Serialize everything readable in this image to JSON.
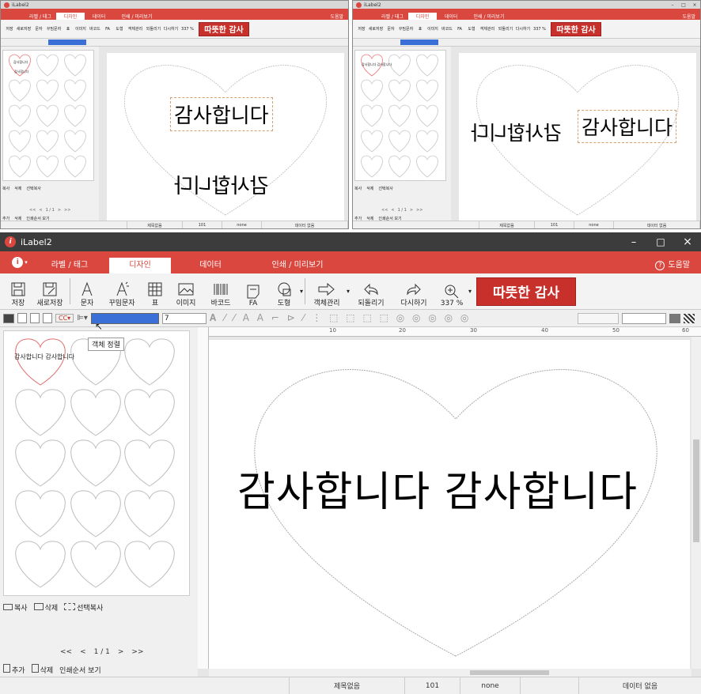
{
  "app": {
    "title": "iLabel2"
  },
  "tabs": [
    {
      "label": "라벨 / 태그"
    },
    {
      "label": "디자인"
    },
    {
      "label": "데이터"
    },
    {
      "label": "인쇄 / 미리보기"
    }
  ],
  "help_label": "도움말",
  "ribbon": [
    {
      "label": "저장",
      "icon": "save-icon"
    },
    {
      "label": "새로저장",
      "icon": "save-as-icon"
    },
    {
      "label": "문자",
      "icon": "text-icon"
    },
    {
      "label": "꾸밈문자",
      "icon": "fancy-text-icon"
    },
    {
      "label": "표",
      "icon": "table-icon"
    },
    {
      "label": "이미지",
      "icon": "image-icon"
    },
    {
      "label": "바코드",
      "icon": "barcode-icon"
    },
    {
      "label": "FA",
      "icon": "fa-icon"
    },
    {
      "label": "도형",
      "icon": "shape-icon"
    },
    {
      "label": "객체관리",
      "icon": "object-manage-icon"
    },
    {
      "label": "되돌리기",
      "icon": "undo-icon"
    },
    {
      "label": "다시하기",
      "icon": "redo-icon"
    },
    {
      "label": "337 %",
      "icon": "zoom-icon"
    }
  ],
  "banner": "따뜻한 감사",
  "font_size_value": "7",
  "tooltip": "객체 정렬",
  "ruler_marks": [
    "10",
    "20",
    "30",
    "40",
    "50",
    "60"
  ],
  "thumb_text_main": "감사합니다 감사합니다",
  "thumb_text_top": "감사합니다 감사합니다",
  "thumb_text_topleft_1": "감사합니다",
  "thumb_text_topleft_2": "감사합니다",
  "canvas_text": "감사합니다 감사합니다",
  "left_tools": {
    "copy": "복사",
    "delete": "삭제",
    "select_copy": "선택복사"
  },
  "pager": {
    "first": "<<",
    "prev": "<",
    "page": "1 / 1",
    "next": ">",
    "last": ">>"
  },
  "bottom_tools": {
    "add": "추가",
    "delete": "삭제",
    "print_order": "인쇄순서 보기"
  },
  "status": {
    "title": "제목없음",
    "code": "101",
    "none": "none",
    "data": "데이터 없음"
  },
  "top_left_window": {
    "title": "iLabel2",
    "text_upright": "감사합니다",
    "text_mirrored": "감사합니다"
  },
  "top_right_window": {
    "title": "iLabel2",
    "text_upright": "감사합니다",
    "text_mirrored": "감사합니다"
  },
  "colors": {
    "accent": "#d9473f",
    "banner": "#c8302b"
  }
}
